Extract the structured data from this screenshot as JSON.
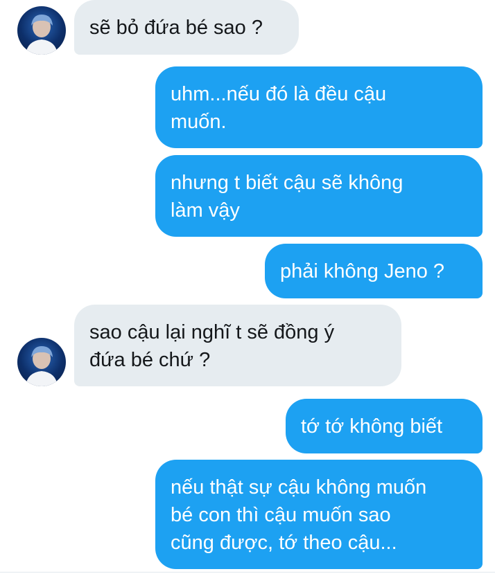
{
  "contact": {
    "avatar_icon": "user-avatar-icon"
  },
  "messages": [
    {
      "side": "received",
      "text": "sẽ bỏ đứa bé sao ?"
    },
    {
      "side": "sent",
      "text": "uhm...nếu đó là đều cậu\nmuốn."
    },
    {
      "side": "sent",
      "text": "nhưng t biết cậu sẽ không\nlàm vậy"
    },
    {
      "side": "sent",
      "text": "phải không Jeno ?"
    },
    {
      "side": "received",
      "text": "sao cậu lại nghĩ t sẽ đồng ý\nđứa bé chứ ?"
    },
    {
      "side": "sent",
      "text": "tớ tớ không biết"
    },
    {
      "side": "sent",
      "text": "nếu thật sự cậu không muốn\nbé con thì cậu muốn sao\ncũng được, tớ theo cậu..."
    }
  ],
  "colors": {
    "sent_bubble": "#1da1f2",
    "received_bubble": "#e6ecf0",
    "sent_text": "#ffffff",
    "received_text": "#14171a"
  }
}
